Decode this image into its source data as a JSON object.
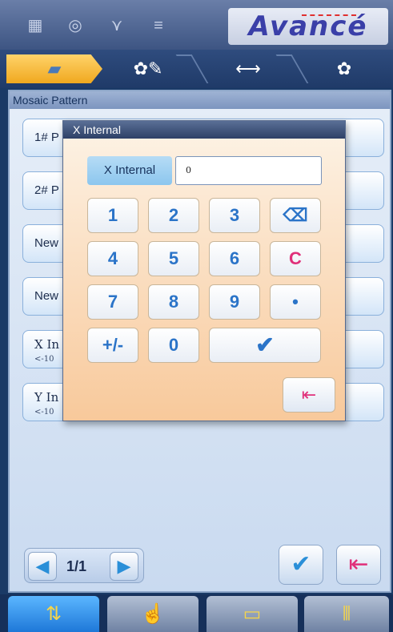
{
  "brand": {
    "name": "Avancé"
  },
  "panel": {
    "title": "Mosaic Pattern",
    "rows": [
      {
        "label": "1# P",
        "sub": ""
      },
      {
        "label": "2# P",
        "sub": ""
      },
      {
        "label": "New",
        "sub": ""
      },
      {
        "label": "New",
        "sub": ""
      },
      {
        "label": "X In",
        "sub": "<-10"
      },
      {
        "label": "Y In",
        "sub": "<-10"
      }
    ],
    "pager": {
      "text": "1/1"
    }
  },
  "dialog": {
    "title": "X Internal",
    "field_label": "X Internal",
    "field_value": "0",
    "keys": [
      "1",
      "2",
      "3",
      "4",
      "5",
      "6",
      "7",
      "8",
      "9",
      "+/-",
      "0"
    ],
    "clear": "C",
    "dot": "•"
  }
}
